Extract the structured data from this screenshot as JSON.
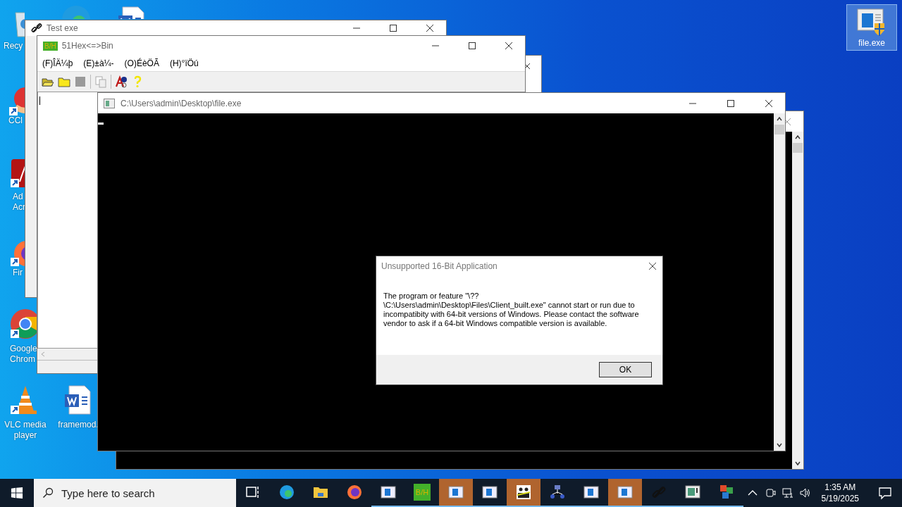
{
  "desktop_icons": [
    {
      "kind": "recycle",
      "lines": [
        "Recy"
      ],
      "shortcut": false
    },
    {
      "kind": "edge"
    },
    {
      "kind": "word"
    },
    {
      "kind": "ccleaner",
      "lines": [
        "CCl"
      ],
      "shortcut": true
    },
    {
      "kind": "acrobat",
      "lines": [
        "Ad",
        "Acr"
      ],
      "shortcut": true
    },
    {
      "kind": "firefox",
      "lines": [
        "Fir"
      ],
      "shortcut": true
    },
    {
      "kind": "chrome",
      "lines": [
        "Google",
        "Chrom"
      ],
      "shortcut": true
    },
    {
      "kind": "vlc",
      "lines": [
        "VLC media",
        "player"
      ],
      "shortcut": true
    },
    {
      "kind": "word",
      "lines": [
        "framemod."
      ],
      "shortcut": false
    }
  ],
  "selected_icon": {
    "label": "file.exe",
    "selected": true
  },
  "test_window": {
    "title": "Test exe"
  },
  "hex_window": {
    "logo": "B/H",
    "title": "51Hex<=>Bin",
    "menu": [
      "(F)ÎÄ¼þ",
      "(E)±à¼-",
      "(O)ÉèÖÃ",
      "(H)°ïÖú"
    ],
    "toolbar": [
      {
        "kind": "open",
        "disabled": false
      },
      {
        "kind": "folder",
        "disabled": false
      },
      {
        "kind": "stop",
        "disabled": true
      },
      {
        "kind": "copy",
        "disabled": true
      },
      {
        "kind": "font",
        "disabled": false
      },
      {
        "kind": "help",
        "disabled": false
      }
    ]
  },
  "console_window": {
    "title": "C:\\Users\\admin\\Desktop\\file.exe"
  },
  "dialog": {
    "title": "Unsupported 16-Bit Application",
    "message": "The program or feature \"\\??\\C:\\Users\\admin\\Desktop\\Files\\Client_built.exe\" cannot start or run due to incompatibity with 64-bit versions of Windows. Please contact the software vendor to ask if a 64-bit Windows compatible version is available.",
    "button": "OK"
  },
  "taskbar": {
    "search": {
      "placeholder": "Type here to search"
    },
    "apps": [
      {
        "kind": "taskview",
        "running": false,
        "flashing": false
      },
      {
        "kind": "edge",
        "running": false,
        "flashing": false
      },
      {
        "kind": "explorer",
        "running": false,
        "flashing": false
      },
      {
        "kind": "firefox",
        "running": false,
        "flashing": false
      },
      {
        "kind": "window",
        "running": true,
        "flashing": false
      },
      {
        "kind": "bh",
        "label": "B/H",
        "running": true,
        "flashing": false
      },
      {
        "kind": "window",
        "running": true,
        "flashing": true
      },
      {
        "kind": "window",
        "running": true,
        "flashing": false
      },
      {
        "kind": "people",
        "running": true,
        "flashing": true
      },
      {
        "kind": "netapp",
        "running": true,
        "flashing": false
      },
      {
        "kind": "window",
        "running": true,
        "flashing": false
      },
      {
        "kind": "window",
        "running": true,
        "flashing": true
      },
      {
        "kind": "link",
        "running": true,
        "flashing": false
      },
      {
        "kind": "monitor",
        "running": true,
        "flashing": false
      },
      {
        "kind": "office",
        "running": true,
        "flashing": false
      }
    ],
    "clock": {
      "time": "1:35 AM",
      "date": "5/19/2025"
    }
  }
}
